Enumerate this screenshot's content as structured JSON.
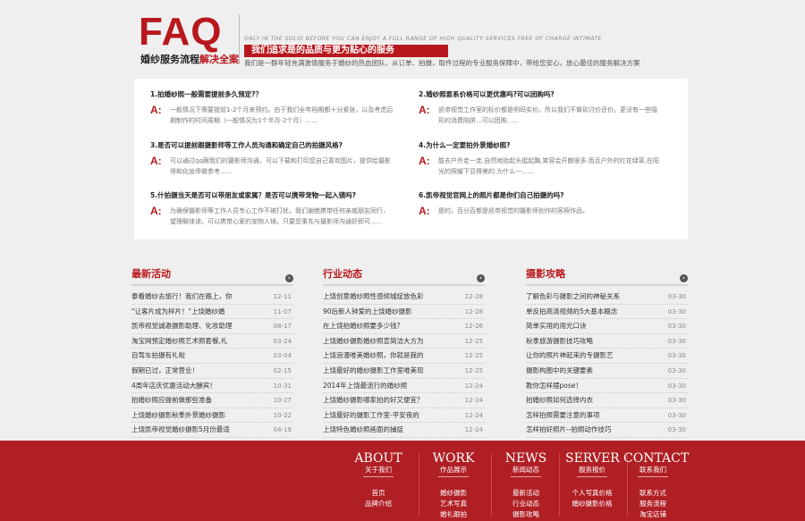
{
  "header": {
    "logo": "FAQ",
    "sub_black": "婚纱服务流程",
    "sub_red": "解决全案",
    "en_line": "ONLY IN THE SOLID BEFORE YOU CAN ENJOY A FULL RANGE OF HIGH QUALITY SERVICES FREE OF CHARGE INTIMATE",
    "slogan": "我们追求是的品质与更为贴心的服务",
    "desc": "我们是一群年轻充满激情服务于婚纱的热血团队，从订单、拍摄，取件过程的专业服务保障中，带给您安心，放心最佳的服务解决方案"
  },
  "faq": [
    {
      "q": "1.拍婚纱照一般需要提前多久预定?？",
      "a": "一般情况下需要提前1-2个月来预约。由于我们全年档期都十分紧张，以及考虑后期制作的时间周期（一般情况为1个半月-2个月）......"
    },
    {
      "q": "2.婚纱照套系价格可以更优惠吗?可以团购吗?",
      "a": "凯帝视觉工作室的标价都是明码实价，所以我们不做砍讨价还价。更没有一些隐形的消费陷阱...可以团购......"
    },
    {
      "q": "3.是否可以提前跟摄影师等工作人员沟通和确定自己的拍摄风格?",
      "a": "可以通过qq跟我们的摄影师沟通，可以下载和打印您自己喜欢图片，提供给摄影师和化妆师做参考......"
    },
    {
      "q": "4.为什么一定要拍外景婚纱照?",
      "a": "能去户外走一走,自然地抬起头挺起胸,笑容会开朗很多.而且户外的红花绿草,在阳光的照耀下显得美的.为什么一......"
    },
    {
      "q": "5.什拍摄当天是否可以带朋友或家属？是否可以携带宠物一起入镜吗?",
      "a": "为确保摄影师等工作人员专心工作不被打扰，我们谢绝携带任何亲戚朋友同行，望理解体谅。可以携带心爱的宠物入镜，只要您事先与摄影师沟通好即可......"
    },
    {
      "q": "6.凯帝视觉官网上的照片都是你们自己拍摄的吗?",
      "a": "是的，百分百都是凯帝视觉的摄影师创作的客照作品。"
    }
  ],
  "columns": [
    {
      "title": "最新活动",
      "more": "›",
      "items": [
        {
          "t": "泰看婚纱去旅行！我们在路上，你",
          "d": "12-11"
        },
        {
          "t": "\"让客片成为样片！\"上饶婚纱婚",
          "d": "11-07"
        },
        {
          "t": "凯帝视觉诚邀摄影助理、化妆助理",
          "d": "08-17"
        },
        {
          "t": "淘宝网预定婚纱照艺术照套餐,礼",
          "d": "03-24"
        },
        {
          "t": "自驾车拍摄有礼啦",
          "d": "03-04"
        },
        {
          "t": "假期已过，正常营业！",
          "d": "02-15"
        },
        {
          "t": "4周年店庆优惠活动大酬宾！",
          "d": "10-31"
        },
        {
          "t": "拍婚纱照应提前做那些准备",
          "d": "10-27"
        },
        {
          "t": "上饶婚纱摄影秋季外景婚纱摄影",
          "d": "10-22"
        },
        {
          "t": "上饶凯帝视觉婚纱摄影5月份最适",
          "d": "04-19"
        }
      ]
    },
    {
      "title": "行业动态",
      "more": "›",
      "items": [
        {
          "t": "上饶创意婚纱照性感倾城绽放色彩",
          "d": "12-28"
        },
        {
          "t": "90后新人钟爱的上饶婚纱摄影",
          "d": "12-28"
        },
        {
          "t": "在上饶拍婚纱照要多少钱？",
          "d": "12-26"
        },
        {
          "t": "上饶婚纱摄影婚纱照宣简洁大方为",
          "d": "12-25"
        },
        {
          "t": "上饶浪漫唯美婚纱照，你就是我的",
          "d": "12-25"
        },
        {
          "t": "上饶最好的婚纱摄影工作室唯美现",
          "d": "12-25"
        },
        {
          "t": "2014年上饶最流行的婚纱照",
          "d": "12-24"
        },
        {
          "t": "上饶婚纱摄影哪家拍的好又便宜？",
          "d": "12-24"
        },
        {
          "t": "上饶最好的摄影工作室-平安夜的",
          "d": "12-24"
        },
        {
          "t": "上饶特色婚纱照画面的捕捉",
          "d": "12-24"
        }
      ]
    },
    {
      "title": "摄影攻略",
      "more": "›",
      "items": [
        {
          "t": "了解色彩与摄影之间的神秘关系",
          "d": "03-30"
        },
        {
          "t": "单反拍高清视频的5大基本概念",
          "d": "03-30"
        },
        {
          "t": "简单实用的用光口诀",
          "d": "03-30"
        },
        {
          "t": "秋季旅游摄影技巧攻略",
          "d": "03-30"
        },
        {
          "t": "让你的照片神起来的专摄影艺",
          "d": "03-30"
        },
        {
          "t": "摄影构图中的关键要素",
          "d": "03-30"
        },
        {
          "t": "教你怎样摆pose！",
          "d": "03-30"
        },
        {
          "t": "拍婚纱照如何选择内衣",
          "d": "03-30"
        },
        {
          "t": "怎样拍照需要注意的事项",
          "d": "03-30"
        },
        {
          "t": "怎样拍好照片--拍照动作技巧",
          "d": "03-30"
        }
      ]
    }
  ],
  "footer": [
    {
      "en": "ABOUT",
      "cn": "关于我们",
      "links": [
        "首页",
        "品牌介绍"
      ]
    },
    {
      "en": "WORK",
      "cn": "作品展示",
      "links": [
        "婚纱摄影",
        "艺术写真",
        "婚礼跟拍"
      ]
    },
    {
      "en": "NEWS",
      "cn": "新闻动态",
      "links": [
        "最新活动",
        "行业动态",
        "摄影攻略"
      ]
    },
    {
      "en": "SERVER",
      "cn": "服务报价",
      "links": [
        "个人写真价格",
        "婚纱摄影价格"
      ]
    },
    {
      "en": "CONTACT",
      "cn": "联系我们",
      "links": [
        "联系方式",
        "服务流程",
        "淘宝店铺"
      ]
    }
  ]
}
